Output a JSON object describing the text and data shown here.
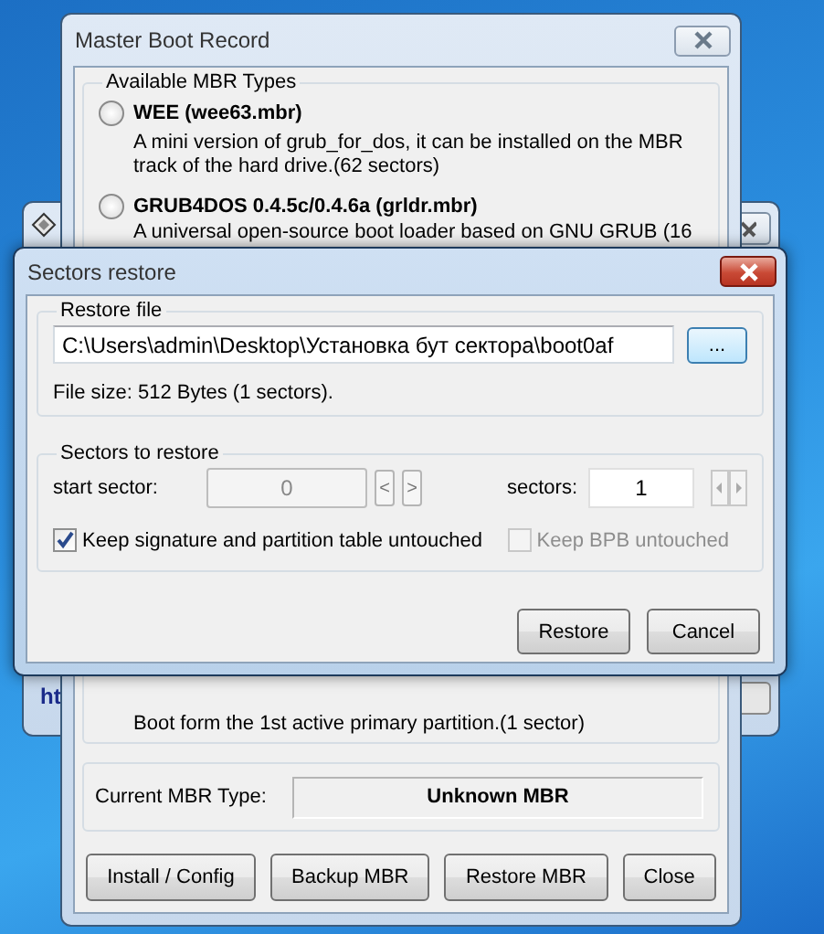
{
  "background_window": {
    "partial_text": "ht"
  },
  "mbr_window": {
    "title": "Master Boot Record",
    "group_title": "Available MBR Types",
    "mbr_types": [
      {
        "name": "WEE (wee63.mbr)",
        "description": "A mini version of grub_for_dos, it can be installed on the MBR track of the hard drive.(62 sectors)",
        "selected": false
      },
      {
        "name": "GRUB4DOS 0.4.5c/0.4.6a (grldr.mbr)",
        "description": "A universal open-source boot loader based on GNU GRUB (16",
        "selected": false
      }
    ],
    "last_type_description": "Boot form the 1st active primary partition.(1 sector)",
    "current_mbr_label": "Current MBR Type:",
    "current_mbr_value": "Unknown MBR",
    "buttons": [
      "Install / Config",
      "Backup MBR",
      "Restore MBR",
      "Close"
    ]
  },
  "dialog": {
    "title": "Sectors restore",
    "restore_file": {
      "group_title": "Restore file",
      "path": "C:\\Users\\admin\\Desktop\\Установка бут сектора\\boot0af",
      "browse_button": "...",
      "file_size": "File size: 512 Bytes (1 sectors)."
    },
    "sectors": {
      "group_title": "Sectors to restore",
      "start_label": "start sector:",
      "start_value": "0",
      "start_disabled": true,
      "prev_button": "<",
      "next_button": ">",
      "count_label": "sectors:",
      "count_value": "1",
      "count_spin_disabled": true
    },
    "checkboxes": [
      {
        "label": "Keep signature and partition table untouched",
        "checked": true,
        "disabled": false
      },
      {
        "label": "Keep BPB untouched",
        "checked": false,
        "disabled": true
      }
    ],
    "buttons": [
      "Restore",
      "Cancel"
    ]
  }
}
